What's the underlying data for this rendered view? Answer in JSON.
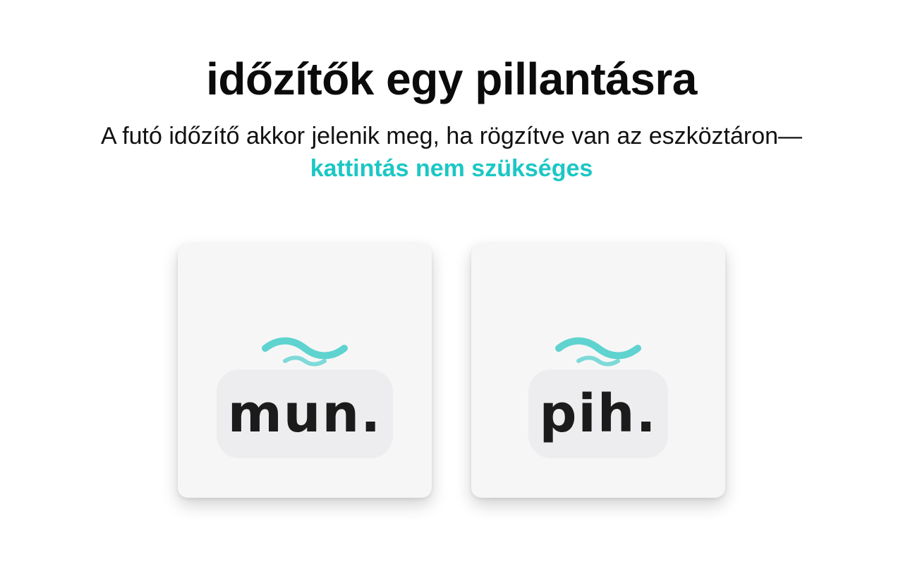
{
  "header": {
    "title": "időzítők egy pillantásra",
    "subtitle_main": "A futó időzítő akkor jelenik meg, ha rögzítve van az eszköztáron—",
    "subtitle_highlight": "kattintás nem szükséges"
  },
  "cards": [
    {
      "icon": "wave-icon",
      "label": "mun."
    },
    {
      "icon": "wave-icon",
      "label": "pih."
    }
  ],
  "colors": {
    "accent": "#1cc7c4",
    "wave": "#5fd3cf",
    "card_bg": "#f7f6f7",
    "badge_bg": "#edecee"
  }
}
